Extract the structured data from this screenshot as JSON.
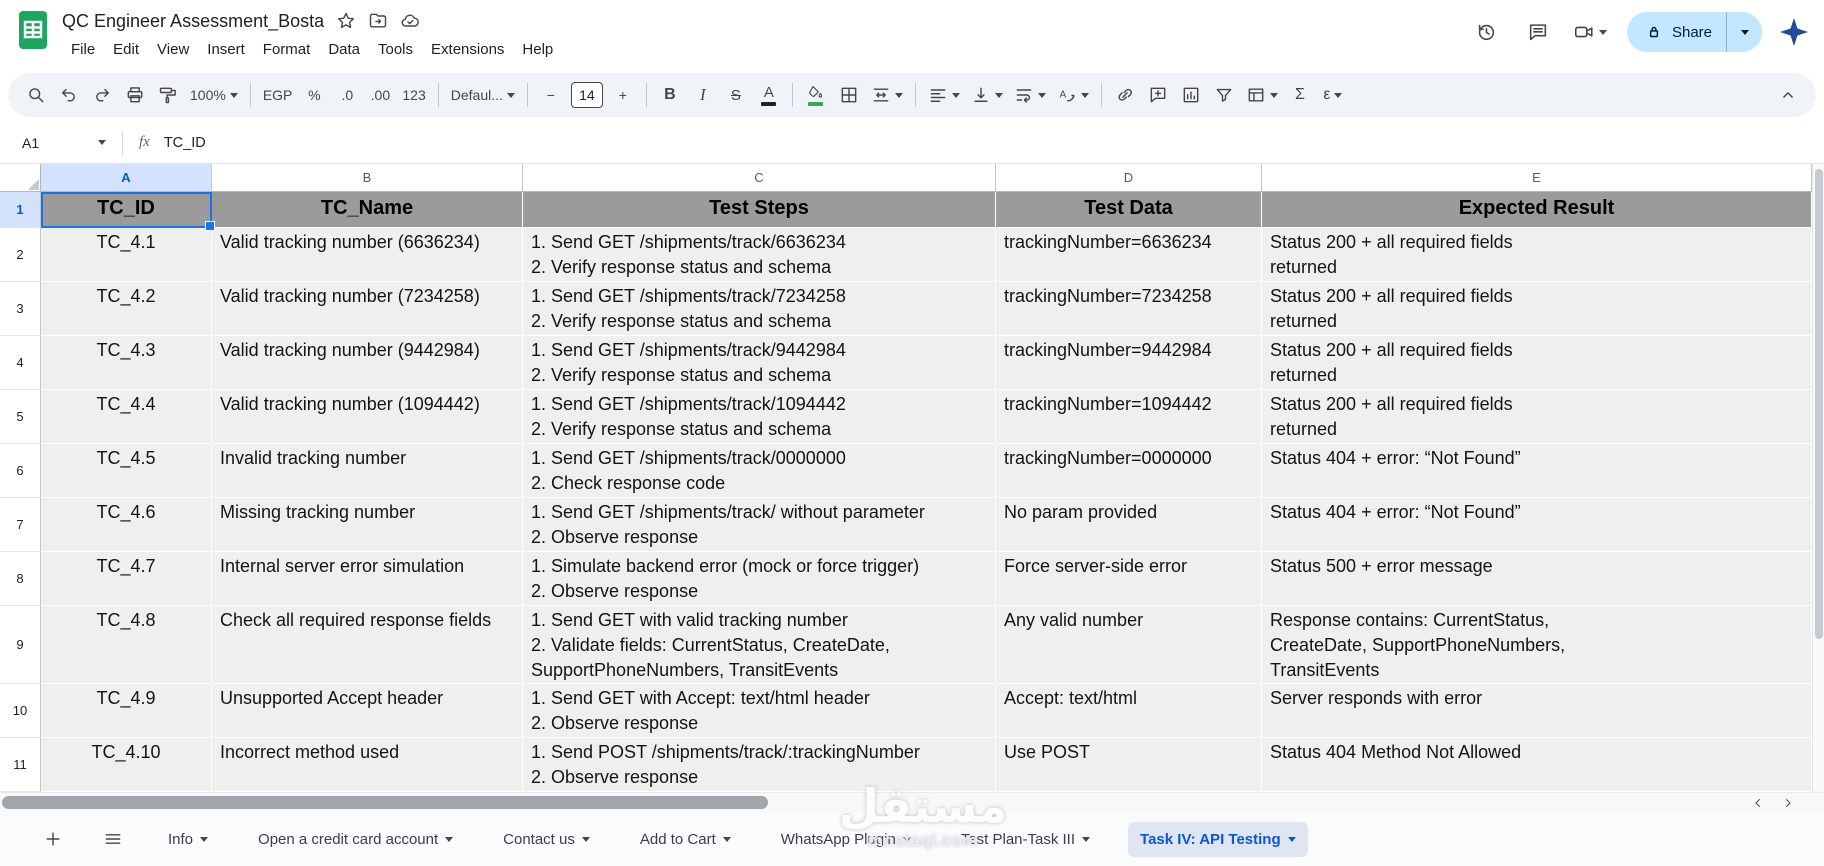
{
  "titlebar": {
    "title": "QC Engineer Assessment_Bosta",
    "menus": [
      "File",
      "Edit",
      "View",
      "Insert",
      "Format",
      "Data",
      "Tools",
      "Extensions",
      "Help"
    ],
    "share": "Share"
  },
  "toolbar": {
    "zoom": "100%",
    "currency": "EGP",
    "percent": "%",
    "dec0": ".0",
    "dec00": ".00",
    "numfmt": "123",
    "font": "Defaul...",
    "size": "14",
    "minus": "−",
    "plus": "+",
    "bold": "B",
    "italic": "I",
    "strike": "S",
    "textcolor": "A",
    "sum": "Σ",
    "more": "ε"
  },
  "formula": {
    "ref": "A1",
    "fx": "fx",
    "value": "TC_ID"
  },
  "grid": {
    "columns": [
      "A",
      "B",
      "C",
      "D",
      "E"
    ],
    "header_num": "1",
    "header": [
      "TC_ID",
      "TC_Name",
      "Test Steps",
      "Test Data",
      "Expected Result"
    ],
    "rows": [
      {
        "num": "2",
        "id": "TC_4.1",
        "name": "Valid tracking number (6636234)",
        "steps": "1. Send GET /shipments/track/6636234\n2. Verify response status and schema",
        "data": "trackingNumber=6636234",
        "expected": "Status 200 + all required fields\nreturned"
      },
      {
        "num": "3",
        "id": "TC_4.2",
        "name": "Valid tracking number (7234258)",
        "steps": "1. Send GET /shipments/track/7234258\n2. Verify response status and schema",
        "data": "trackingNumber=7234258",
        "expected": "Status 200 + all required fields\nreturned"
      },
      {
        "num": "4",
        "id": "TC_4.3",
        "name": "Valid tracking number (9442984)",
        "steps": "1. Send GET /shipments/track/9442984\n2. Verify response status and schema",
        "data": "trackingNumber=9442984",
        "expected": "Status 200 + all required fields\nreturned"
      },
      {
        "num": "5",
        "id": "TC_4.4",
        "name": "Valid tracking number (1094442)",
        "steps": "1. Send GET /shipments/track/1094442\n2. Verify response status and schema",
        "data": "trackingNumber=1094442",
        "expected": "Status 200 + all required fields\nreturned"
      },
      {
        "num": "6",
        "id": "TC_4.5",
        "name": "Invalid tracking number",
        "steps": "1. Send GET /shipments/track/0000000\n2. Check response code",
        "data": "trackingNumber=0000000",
        "expected": "Status 404 + error: “Not Found”"
      },
      {
        "num": "7",
        "id": "TC_4.6",
        "name": "Missing tracking number",
        "steps": "1. Send GET /shipments/track/ without parameter\n2. Observe response",
        "data": "No param provided",
        "expected": "Status 404 + error: “Not Found”"
      },
      {
        "num": "8",
        "id": "TC_4.7",
        "name": "Internal server error simulation",
        "steps": "1. Simulate backend error (mock or force trigger)\n2. Observe response",
        "data": "Force server-side error",
        "expected": "Status 500 + error message"
      },
      {
        "num": "9",
        "id": "TC_4.8",
        "name": "Check all required response fields",
        "steps": "1. Send GET with valid tracking number\n2. Validate fields: CurrentStatus, CreateDate,\nSupportPhoneNumbers, TransitEvents",
        "data": "Any valid number",
        "expected": "Response contains: CurrentStatus,\nCreateDate, SupportPhoneNumbers,\nTransitEvents"
      },
      {
        "num": "10",
        "id": "TC_4.9",
        "name": "Unsupported Accept header",
        "steps": "1. Send GET with Accept: text/html header\n2. Observe response",
        "data": "Accept: text/html",
        "expected": "Server responds with error"
      },
      {
        "num": "11",
        "id": "TC_4.10",
        "name": "Incorrect method used",
        "steps": "1. Send POST /shipments/track/:trackingNumber\n2. Observe response",
        "data": "Use POST",
        "expected": "Status 404 Method Not Allowed"
      }
    ]
  },
  "tabs": {
    "items": [
      "Info",
      "Open a credit card account",
      "Contact us",
      "Add to Cart",
      "WhatsApp Plugin",
      "Test Plan-Task III",
      "Task IV: API Testing"
    ],
    "active": "Task IV: API Testing"
  },
  "watermark": {
    "arabic": "مستقل",
    "latin": "mostaql.com"
  }
}
